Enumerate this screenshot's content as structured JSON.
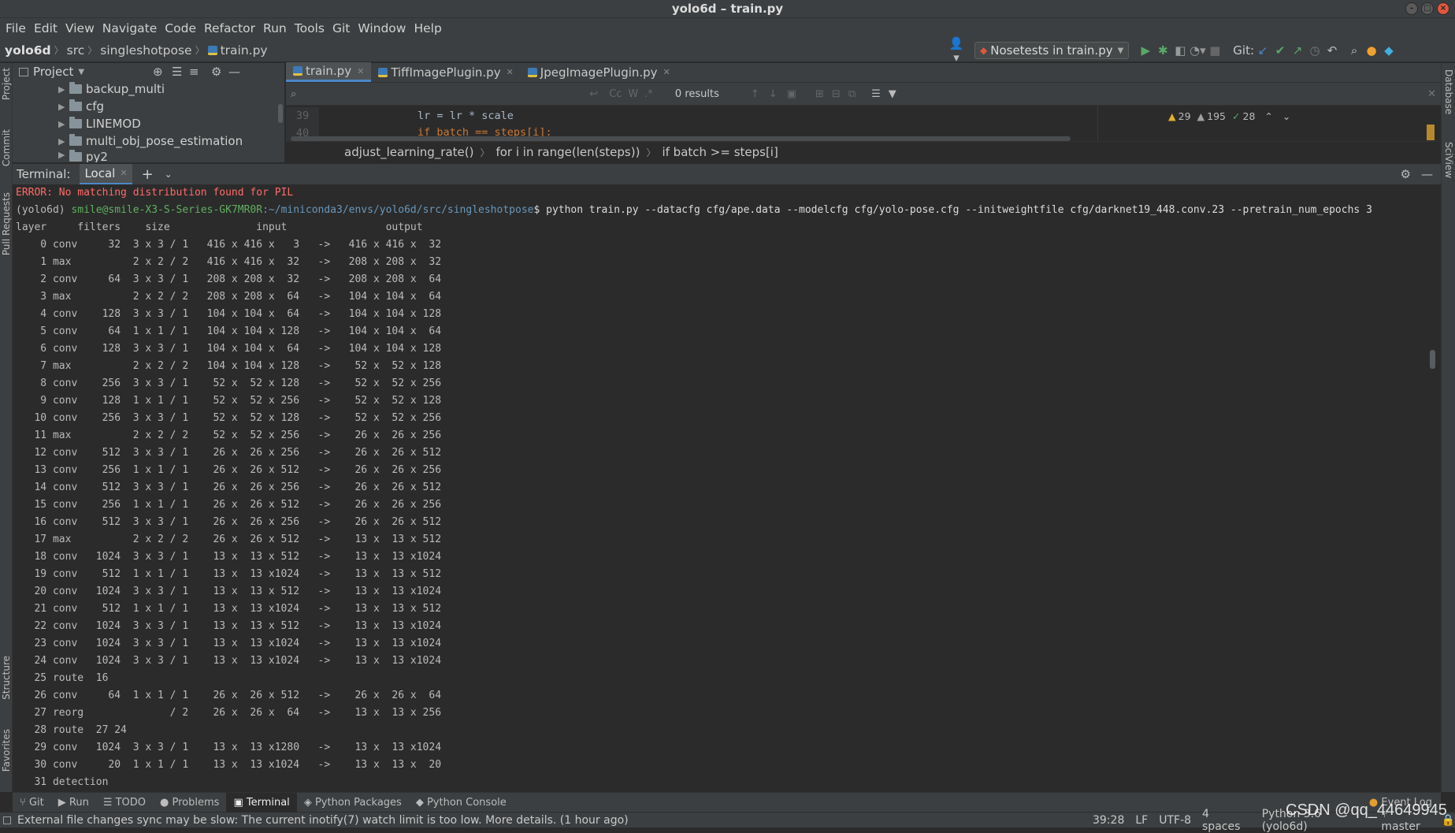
{
  "window": {
    "title": "yolo6d – train.py"
  },
  "menu": [
    "File",
    "Edit",
    "View",
    "Navigate",
    "Code",
    "Refactor",
    "Run",
    "Tools",
    "Git",
    "Window",
    "Help"
  ],
  "breadcrumb": [
    "yolo6d",
    "src",
    "singleshotpose",
    "train.py"
  ],
  "toolbar": {
    "run_config": "Nosetests in train.py",
    "git_label": "Git:"
  },
  "project": {
    "title": "Project",
    "items": [
      "backup_multi",
      "cfg",
      "LINEMOD",
      "multi_obj_pose_estimation",
      "py2"
    ]
  },
  "tabs": [
    {
      "label": "train.py"
    },
    {
      "label": "TiffImagePlugin.py"
    },
    {
      "label": "JpegImagePlugin.py"
    }
  ],
  "search": {
    "results": "0 results"
  },
  "inspections": {
    "warnings": "29",
    "weak": "195",
    "ok": "28"
  },
  "code": [
    {
      "num": "39",
      "text": "lr = lr * scale"
    },
    {
      "num": "40",
      "text": "if batch == steps[i]:"
    }
  ],
  "code_breadcrumb": [
    "adjust_learning_rate()",
    "for i in range(len(steps))",
    "if batch >= steps[i]"
  ],
  "terminal": {
    "title": "Terminal:",
    "tab": "Local",
    "error": "ERROR: No matching distribution found for PIL",
    "prompt_env": "(yolo6d) ",
    "prompt_user": "smile@smile-X3-S-Series-GK7MR0R",
    "prompt_path": ":~/miniconda3/envs/yolo6d/src/singleshotpose",
    "command": "$ python train.py --datacfg cfg/ape.data --modelcfg cfg/yolo-pose.cfg --initweightfile cfg/darknet19_448.conv.23 --pretrain_num_epochs 3",
    "header": "layer     filters    size              input                output",
    "lines": [
      "    0 conv     32  3 x 3 / 1   416 x 416 x   3   ->   416 x 416 x  32",
      "    1 max          2 x 2 / 2   416 x 416 x  32   ->   208 x 208 x  32",
      "    2 conv     64  3 x 3 / 1   208 x 208 x  32   ->   208 x 208 x  64",
      "    3 max          2 x 2 / 2   208 x 208 x  64   ->   104 x 104 x  64",
      "    4 conv    128  3 x 3 / 1   104 x 104 x  64   ->   104 x 104 x 128",
      "    5 conv     64  1 x 1 / 1   104 x 104 x 128   ->   104 x 104 x  64",
      "    6 conv    128  3 x 3 / 1   104 x 104 x  64   ->   104 x 104 x 128",
      "    7 max          2 x 2 / 2   104 x 104 x 128   ->    52 x  52 x 128",
      "    8 conv    256  3 x 3 / 1    52 x  52 x 128   ->    52 x  52 x 256",
      "    9 conv    128  1 x 1 / 1    52 x  52 x 256   ->    52 x  52 x 128",
      "   10 conv    256  3 x 3 / 1    52 x  52 x 128   ->    52 x  52 x 256",
      "   11 max          2 x 2 / 2    52 x  52 x 256   ->    26 x  26 x 256",
      "   12 conv    512  3 x 3 / 1    26 x  26 x 256   ->    26 x  26 x 512",
      "   13 conv    256  1 x 1 / 1    26 x  26 x 512   ->    26 x  26 x 256",
      "   14 conv    512  3 x 3 / 1    26 x  26 x 256   ->    26 x  26 x 512",
      "   15 conv    256  1 x 1 / 1    26 x  26 x 512   ->    26 x  26 x 256",
      "   16 conv    512  3 x 3 / 1    26 x  26 x 256   ->    26 x  26 x 512",
      "   17 max          2 x 2 / 2    26 x  26 x 512   ->    13 x  13 x 512",
      "   18 conv   1024  3 x 3 / 1    13 x  13 x 512   ->    13 x  13 x1024",
      "   19 conv    512  1 x 1 / 1    13 x  13 x1024   ->    13 x  13 x 512",
      "   20 conv   1024  3 x 3 / 1    13 x  13 x 512   ->    13 x  13 x1024",
      "   21 conv    512  1 x 1 / 1    13 x  13 x1024   ->    13 x  13 x 512",
      "   22 conv   1024  3 x 3 / 1    13 x  13 x 512   ->    13 x  13 x1024",
      "   23 conv   1024  3 x 3 / 1    13 x  13 x1024   ->    13 x  13 x1024",
      "   24 conv   1024  3 x 3 / 1    13 x  13 x1024   ->    13 x  13 x1024",
      "   25 route  16",
      "   26 conv     64  1 x 1 / 1    26 x  26 x 512   ->    26 x  26 x  64",
      "   27 reorg              / 2    26 x  26 x  64   ->    13 x  13 x 256",
      "   28 route  27 24",
      "   29 conv   1024  3 x 3 / 1    13 x  13 x1280   ->    13 x  13 x1024",
      "   30 conv     20  1 x 1 / 1    13 x  13 x1024   ->    13 x  13 x  20",
      "   31 detection"
    ]
  },
  "tool_windows": [
    "Git",
    "Run",
    "TODO",
    "Problems",
    "Terminal",
    "Python Packages",
    "Python Console"
  ],
  "event_log": "Event Log",
  "left_strip": [
    "Project",
    "Commit",
    "Pull Requests",
    "Structure",
    "Favorites"
  ],
  "right_strip": [
    "Database",
    "SciView"
  ],
  "status": {
    "message": "External file changes sync may be slow: The current inotify(7) watch limit is too low. More details. (1 hour ago)",
    "position": "39:28",
    "line_sep": "LF",
    "encoding": "UTF-8",
    "indent": "4 spaces",
    "interpreter": "Python 3.6 (yolo6d)",
    "branch": "master"
  },
  "watermark": "CSDN @qq_44649945",
  "colors": {
    "accent": "#4a88c7",
    "error": "#ff6b68",
    "prompt_user": "#5faf5f",
    "prompt_path": "#6897bb",
    "run_green": "#59a869"
  }
}
